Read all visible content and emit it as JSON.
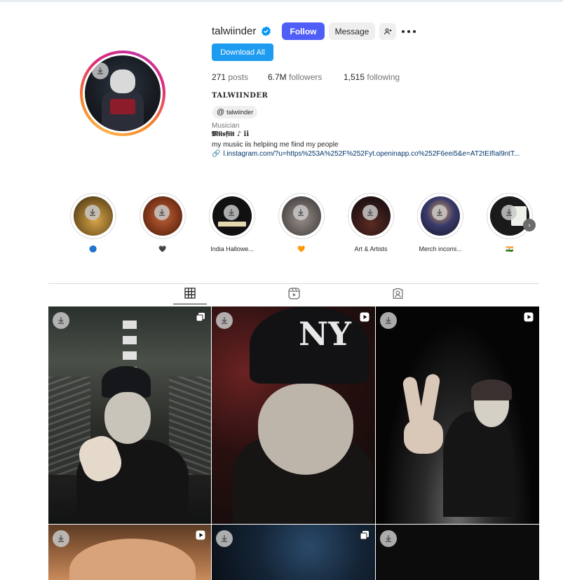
{
  "profile": {
    "username": "talwiinder",
    "follow_label": "Follow",
    "message_label": "Message",
    "download_all_label": "Download All",
    "posts_count": "271",
    "posts_label": "posts",
    "followers_count": "6.7M",
    "followers_label": "followers",
    "following_count": "1,515",
    "following_label": "following",
    "full_name": "TALWIINDER",
    "threads_handle": "talwiinder",
    "category": "Musician",
    "bio_line1": "𝕸𝖎𝖎𝖘𝖋𝖎𝖎𝖙 ♪ ii",
    "bio_line2": "my musiic iis helpiing me fiind my people",
    "bio_link": "l.instagram.com/?u=https%253A%252F%252Fyt.openinapp.co%252F6eei5&e=AT2tEIfIal9ntT..."
  },
  "highlights": [
    {
      "label": "🔵",
      "color": "#b58a3a"
    },
    {
      "label": "🖤",
      "color": "#9c4a2a"
    },
    {
      "label": "India Hallowe...",
      "color": "#141414"
    },
    {
      "label": "🧡",
      "color": "#6a6a72"
    },
    {
      "label": "Art & Artists",
      "color": "#2a1e1e"
    },
    {
      "label": "Merch incomi...",
      "color": "#26304a"
    },
    {
      "label": "🇮🇳",
      "color": "#1c1c1c"
    }
  ],
  "tabs": [
    {
      "name": "posts-grid",
      "icon": "grid-icon"
    },
    {
      "name": "reels",
      "icon": "reels-icon"
    },
    {
      "name": "tagged",
      "icon": "tagged-icon"
    }
  ],
  "posts": [
    {
      "type": "carousel",
      "icon": "carousel-icon"
    },
    {
      "type": "reel",
      "icon": "reel-icon"
    },
    {
      "type": "reel",
      "icon": "reel-icon"
    },
    {
      "type": "reel",
      "icon": "reel-icon"
    },
    {
      "type": "carousel",
      "icon": "carousel-icon"
    },
    {
      "type": "image",
      "icon": ""
    }
  ]
}
